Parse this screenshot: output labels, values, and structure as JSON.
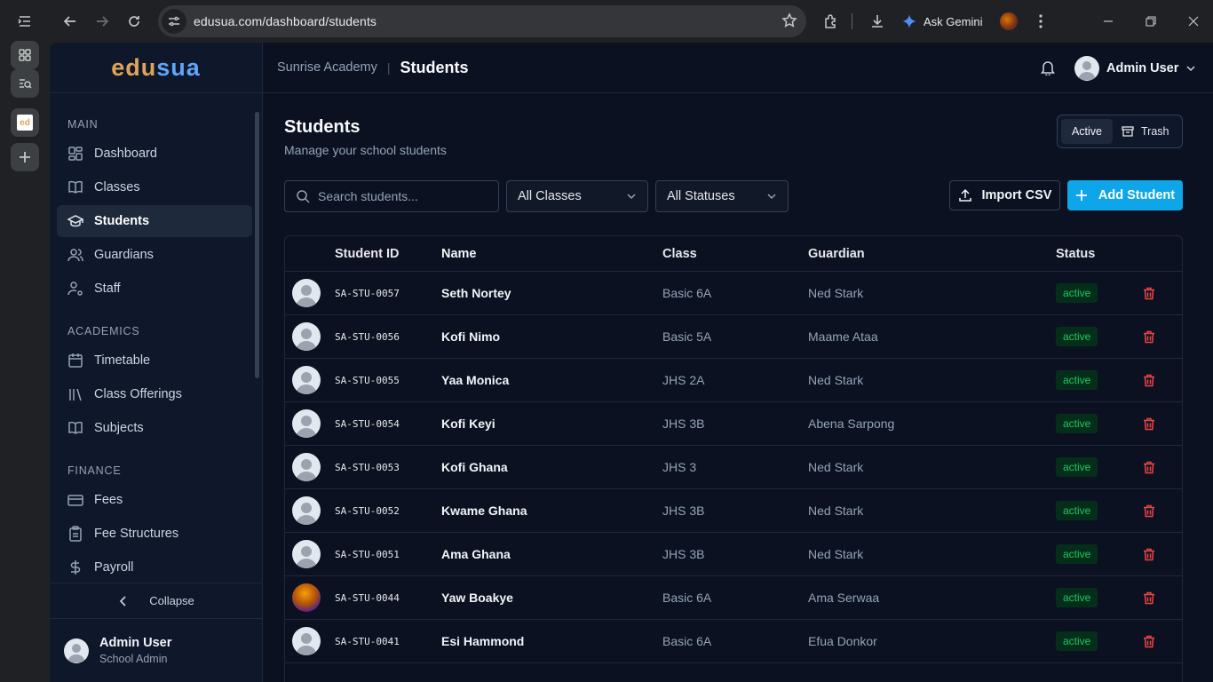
{
  "browser": {
    "url": "edusua.com/dashboard/students",
    "ask_gemini": "Ask Gemini",
    "tabs_strip": [
      {
        "icon": "grid-icon"
      },
      {
        "icon": "tab-search-icon"
      },
      {
        "icon": "edusua-favicon",
        "label": "ed"
      },
      {
        "icon": "plus-icon"
      }
    ]
  },
  "app": {
    "logo_part1": "edu",
    "logo_part2": "sua"
  },
  "header": {
    "school": "Sunrise Academy",
    "separator": "|",
    "page": "Students",
    "user_name": "Admin User"
  },
  "sidebar": {
    "sections": [
      {
        "title": "MAIN",
        "items": [
          {
            "label": "Dashboard",
            "icon": "dashboard-icon",
            "active": false
          },
          {
            "label": "Classes",
            "icon": "book-open-icon",
            "active": false
          },
          {
            "label": "Students",
            "icon": "graduation-cap-icon",
            "active": true
          },
          {
            "label": "Guardians",
            "icon": "users-icon",
            "active": false
          },
          {
            "label": "Staff",
            "icon": "user-cog-icon",
            "active": false
          }
        ]
      },
      {
        "title": "ACADEMICS",
        "items": [
          {
            "label": "Timetable",
            "icon": "calendar-icon",
            "active": false
          },
          {
            "label": "Class Offerings",
            "icon": "library-icon",
            "active": false
          },
          {
            "label": "Subjects",
            "icon": "book-icon",
            "active": false
          }
        ]
      },
      {
        "title": "FINANCE",
        "items": [
          {
            "label": "Fees",
            "icon": "credit-card-icon",
            "active": false
          },
          {
            "label": "Fee Structures",
            "icon": "clipboard-icon",
            "active": false
          },
          {
            "label": "Payroll",
            "icon": "dollar-icon",
            "active": false
          }
        ]
      }
    ],
    "collapse_label": "Collapse",
    "user_name": "Admin User",
    "user_role": "School Admin"
  },
  "page": {
    "title": "Students",
    "subtitle": "Manage your school students",
    "toggle_active": "Active",
    "toggle_trash": "Trash",
    "search_placeholder": "Search students...",
    "class_filter": "All Classes",
    "status_filter": "All Statuses",
    "import_label": "Import CSV",
    "add_label": "Add Student"
  },
  "table": {
    "columns": [
      "Student ID",
      "Name",
      "Class",
      "Guardian",
      "Status"
    ],
    "rows": [
      {
        "id": "SA-STU-0057",
        "name": "Seth Nortey",
        "class": "Basic 6A",
        "guardian": "Ned Stark",
        "status": "active",
        "photo": false
      },
      {
        "id": "SA-STU-0056",
        "name": "Kofi Nimo",
        "class": "Basic 5A",
        "guardian": "Maame Ataa",
        "status": "active",
        "photo": false
      },
      {
        "id": "SA-STU-0055",
        "name": "Yaa Monica",
        "class": "JHS 2A",
        "guardian": "Ned Stark",
        "status": "active",
        "photo": false
      },
      {
        "id": "SA-STU-0054",
        "name": "Kofi Keyi",
        "class": "JHS 3B",
        "guardian": "Abena Sarpong",
        "status": "active",
        "photo": false
      },
      {
        "id": "SA-STU-0053",
        "name": "Kofi Ghana",
        "class": "JHS 3",
        "guardian": "Ned Stark",
        "status": "active",
        "photo": false
      },
      {
        "id": "SA-STU-0052",
        "name": "Kwame Ghana",
        "class": "JHS 3B",
        "guardian": "Ned Stark",
        "status": "active",
        "photo": false
      },
      {
        "id": "SA-STU-0051",
        "name": "Ama Ghana",
        "class": "JHS 3B",
        "guardian": "Ned Stark",
        "status": "active",
        "photo": false
      },
      {
        "id": "SA-STU-0044",
        "name": "Yaw Boakye",
        "class": "Basic 6A",
        "guardian": "Ama Serwaa",
        "status": "active",
        "photo": true
      },
      {
        "id": "SA-STU-0041",
        "name": "Esi Hammond",
        "class": "Basic 6A",
        "guardian": "Efua Donkor",
        "status": "active",
        "photo": false
      }
    ]
  },
  "colors": {
    "accent": "#0ea5e9",
    "logo_orange": "#e0a458",
    "logo_blue": "#60a5fa",
    "status_green": "#22c55e",
    "delete_red": "#ef4444"
  }
}
